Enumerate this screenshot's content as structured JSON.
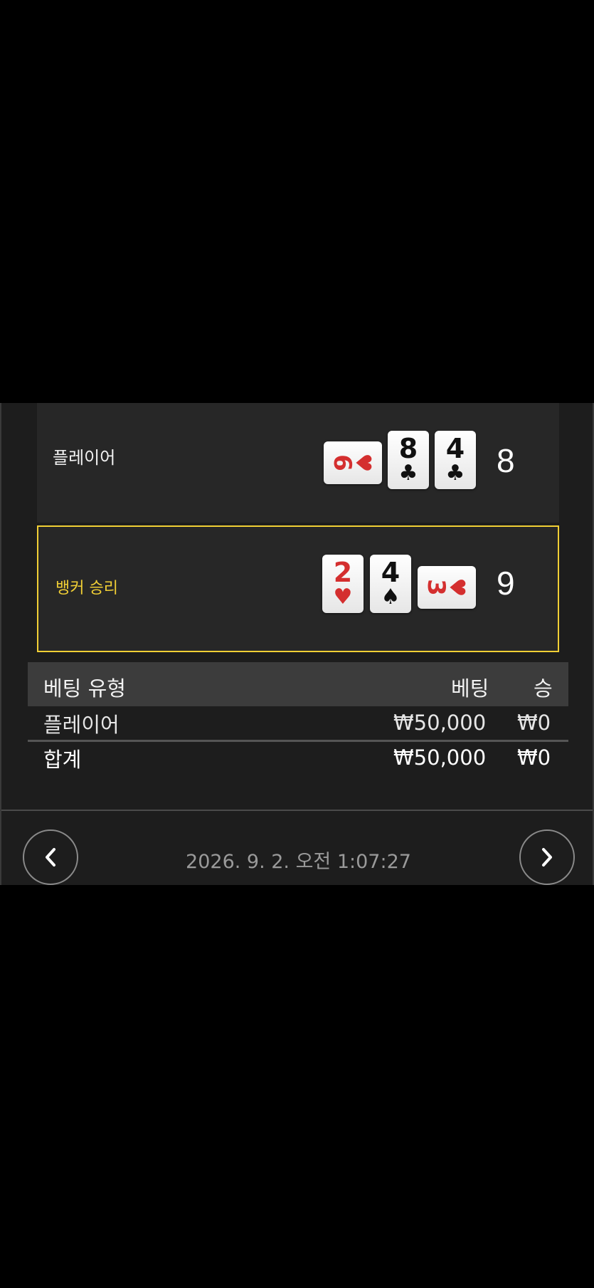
{
  "hands": {
    "player": {
      "label": "플레이어",
      "total": "8",
      "cards": [
        {
          "rank": "6",
          "suit": "♥",
          "color": "red",
          "orientation": "horizontal"
        },
        {
          "rank": "8",
          "suit": "♣",
          "color": "black",
          "orientation": "vertical"
        },
        {
          "rank": "4",
          "suit": "♣",
          "color": "black",
          "orientation": "vertical"
        }
      ]
    },
    "banker": {
      "label": "뱅커 승리",
      "total": "9",
      "cards": [
        {
          "rank": "2",
          "suit": "♥",
          "color": "red",
          "orientation": "vertical"
        },
        {
          "rank": "4",
          "suit": "♠",
          "color": "black",
          "orientation": "vertical"
        },
        {
          "rank": "3",
          "suit": "♥",
          "color": "red",
          "orientation": "horizontal"
        }
      ]
    }
  },
  "table": {
    "headers": {
      "type": "베팅 유형",
      "bet": "베팅",
      "win": "승"
    },
    "rows": [
      {
        "type": "플레이어",
        "bet": "₩50,000",
        "win": "₩0"
      }
    ],
    "total": {
      "type": "합계",
      "bet": "₩50,000",
      "win": "₩0"
    }
  },
  "footer": {
    "timestamp": "2026. 9. 2. 오전 1:07:27",
    "prev_icon": "chevron-left-icon",
    "next_icon": "chevron-right-icon"
  },
  "colors": {
    "accent": "#f1cf35",
    "background": "#1d1d1d",
    "row_bg": "#272727",
    "header_bg": "#3c3c3c"
  }
}
